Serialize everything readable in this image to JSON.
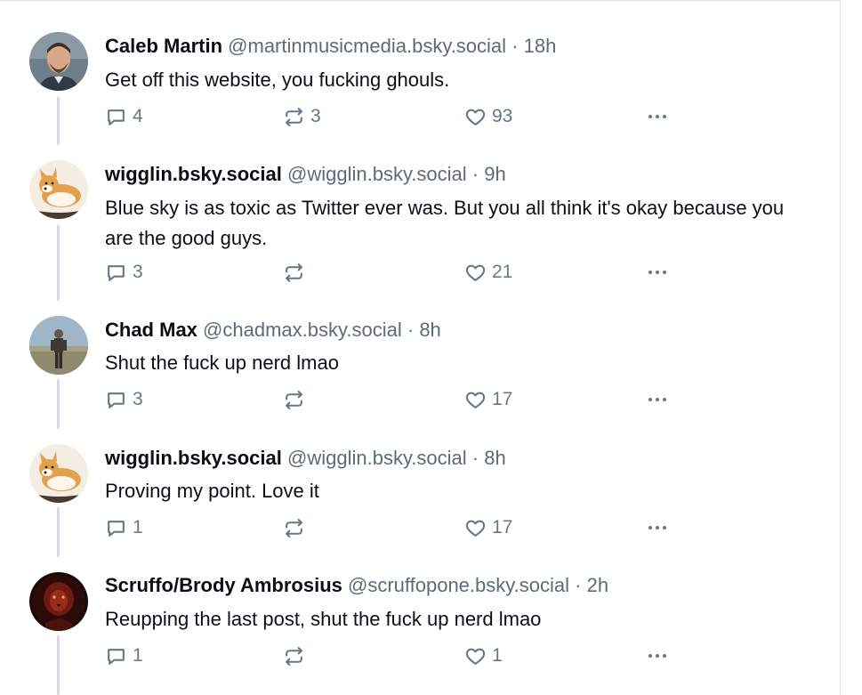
{
  "posts": [
    {
      "name": "Caleb Martin",
      "handle": "@martinmusicmedia.bsky.social",
      "time": "18h",
      "text": "Get off this website, you fucking ghouls.",
      "replies": "4",
      "reposts": "3",
      "likes": "93",
      "avatar": "man-portrait"
    },
    {
      "name": "wigglin.bsky.social",
      "handle": "@wigglin.bsky.social",
      "time": "9h",
      "text": "Blue sky is as toxic as Twitter ever was. But you all think it's okay because you are the good guys.",
      "replies": "3",
      "reposts": "",
      "likes": "21",
      "avatar": "corgi"
    },
    {
      "name": "Chad Max",
      "handle": "@chadmax.bsky.social",
      "time": "8h",
      "text": "Shut the fuck up nerd lmao",
      "replies": "3",
      "reposts": "",
      "likes": "17",
      "avatar": "desert-figure"
    },
    {
      "name": "wigglin.bsky.social",
      "handle": "@wigglin.bsky.social",
      "time": "8h",
      "text": "Proving my point. Love it",
      "replies": "1",
      "reposts": "",
      "likes": "17",
      "avatar": "corgi"
    },
    {
      "name": "Scruffo/Brody Ambrosius",
      "handle": "@scruffopone.bsky.social",
      "time": "2h",
      "text": "Reupping the last post, shut the fuck up nerd lmao",
      "replies": "1",
      "reposts": "",
      "likes": "1",
      "avatar": "red-lion"
    }
  ],
  "separator": "·",
  "colors": {
    "text": "#0b0f14",
    "muted": "#5b6b7c",
    "icon": "#66778a",
    "thread_line": "#d4dbe2"
  }
}
